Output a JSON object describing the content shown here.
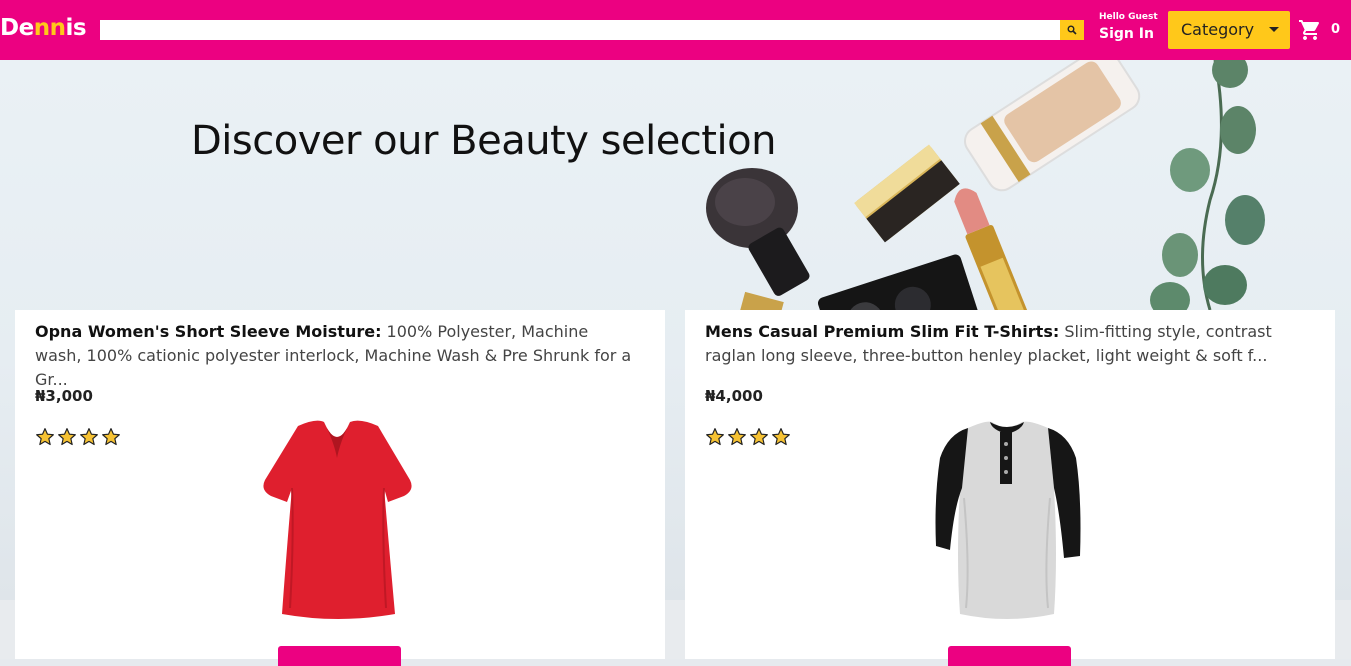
{
  "nav": {
    "brand_prefix": "De",
    "brand_accent": "nn",
    "brand_suffix": "is",
    "search_placeholder": "",
    "greeting": "Hello Guest",
    "sign_in": "Sign In",
    "category_label": "Category",
    "cart_count": "0"
  },
  "hero": {
    "title": "Discover our Beauty selection"
  },
  "products": [
    {
      "name": "Opna Women's Short Sleeve Moisture:",
      "description": " 100% Polyester, Machine wash, 100% cationic polyester interlock, Machine Wash & Pre Shrunk for a Gr...",
      "price": "₦3,000",
      "rating": 4
    },
    {
      "name": "Mens Casual Premium Slim Fit T-Shirts:",
      "description": " Slim-fitting style, contrast raglan long sleeve, three-button henley placket, light weight & soft f...",
      "price": "₦4,000",
      "rating": 4
    }
  ],
  "colors": {
    "brand_pink": "#ec0181",
    "accent_yellow": "#ffc81a"
  }
}
